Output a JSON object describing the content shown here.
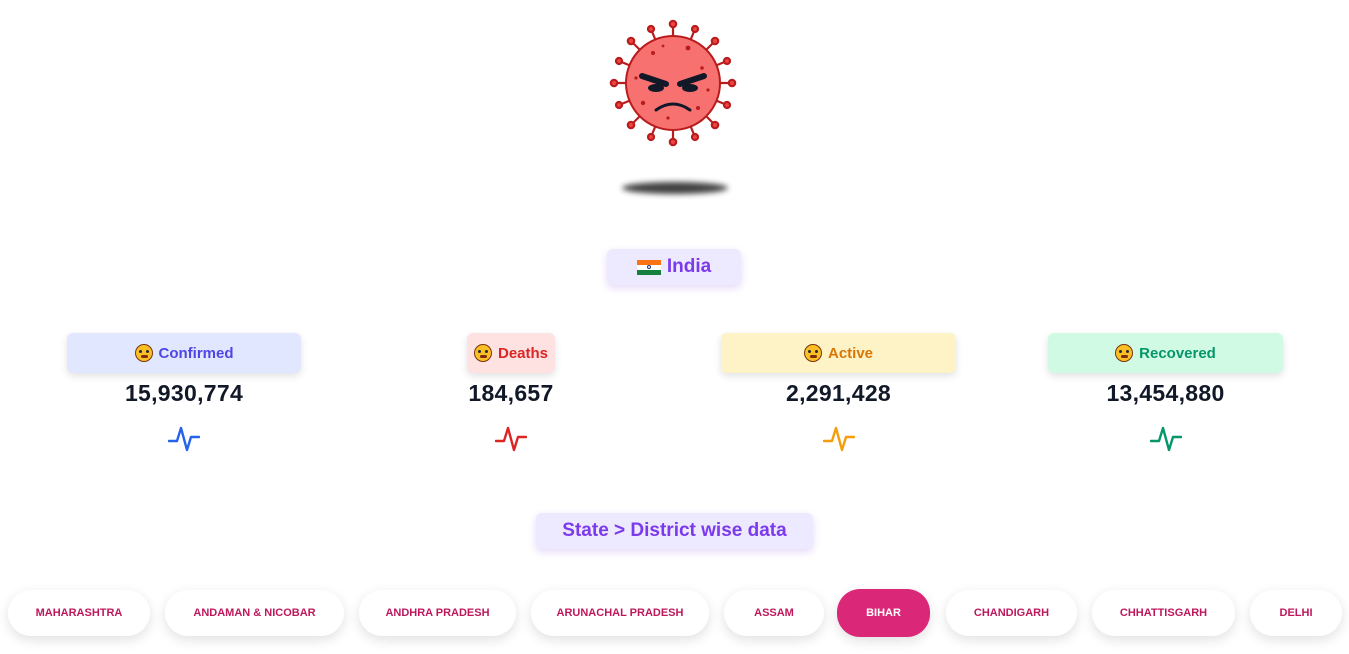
{
  "header": {
    "logo_icon": "angry-virus-icon"
  },
  "country": {
    "flag_icon": "india-flag-icon",
    "name": "India"
  },
  "stats": [
    {
      "label": "Confirmed",
      "value": "15,930,774",
      "emoji_icon": "astonished-face-icon",
      "trend_icon": "pulse-icon",
      "text_color": "#4f46e5",
      "bg_color": "#e0e7ff",
      "line_color": "#2563eb"
    },
    {
      "label": "Deaths",
      "value": "184,657",
      "emoji_icon": "expressionless-face-icon",
      "trend_icon": "pulse-icon",
      "text_color": "#dc2626",
      "bg_color": "#fee2e2",
      "line_color": "#dc2626"
    },
    {
      "label": "Active",
      "value": "2,291,428",
      "emoji_icon": "grimacing-face-icon",
      "trend_icon": "pulse-icon",
      "text_color": "#d97706",
      "bg_color": "#fef3c7",
      "line_color": "#f59e0b"
    },
    {
      "label": "Recovered",
      "value": "13,454,880",
      "emoji_icon": "face-with-mask-icon",
      "trend_icon": "pulse-icon",
      "text_color": "#059669",
      "bg_color": "#d1fae5",
      "line_color": "#059669"
    }
  ],
  "section": {
    "title": "State > District wise data"
  },
  "states": [
    {
      "label": "MAHARASHTRA",
      "active": false
    },
    {
      "label": "ANDAMAN & NICOBAR",
      "active": false
    },
    {
      "label": "ANDHRA PRADESH",
      "active": false
    },
    {
      "label": "ARUNACHAL PRADESH",
      "active": false
    },
    {
      "label": "ASSAM",
      "active": false
    },
    {
      "label": "BIHAR",
      "active": true
    },
    {
      "label": "CHANDIGARH",
      "active": false
    },
    {
      "label": "CHHATTISGARH",
      "active": false
    },
    {
      "label": "DELHI",
      "active": false
    }
  ]
}
